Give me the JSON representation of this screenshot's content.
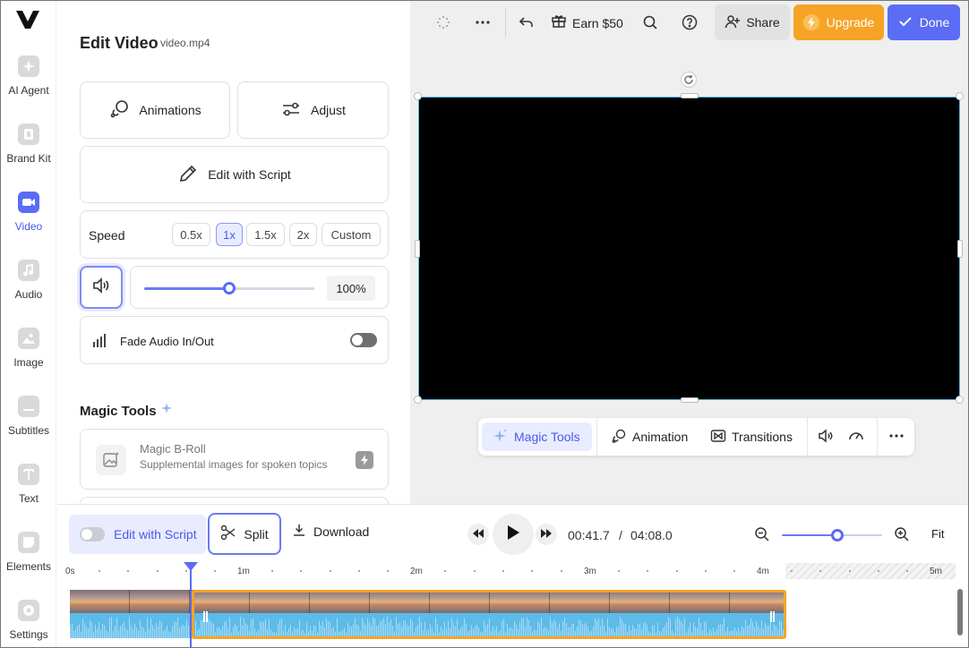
{
  "sidebar": {
    "items": [
      {
        "label": "AI Agent",
        "icon": "sparkle-icon"
      },
      {
        "label": "Brand Kit",
        "icon": "brand-kit-icon"
      },
      {
        "label": "Video",
        "icon": "video-camera-icon",
        "active": true
      },
      {
        "label": "Audio",
        "icon": "music-note-icon"
      },
      {
        "label": "Image",
        "icon": "image-icon"
      },
      {
        "label": "Subtitles",
        "icon": "subtitles-icon"
      },
      {
        "label": "Text",
        "icon": "text-icon"
      },
      {
        "label": "Elements",
        "icon": "elements-icon"
      },
      {
        "label": "Settings",
        "icon": "gear-icon"
      }
    ]
  },
  "panel": {
    "title": "Edit Video",
    "filename": "video.mp4",
    "animations_label": "Animations",
    "adjust_label": "Adjust",
    "edit_script_label": "Edit with Script",
    "speed_label": "Speed",
    "speed_options": [
      "0.5x",
      "1x",
      "1.5x",
      "2x",
      "Custom"
    ],
    "speed_selected": "1x",
    "volume_value": "100%",
    "volume_level": 0.5,
    "fade_label": "Fade Audio In/Out",
    "fade_on": false,
    "magic_tools_title": "Magic Tools",
    "magic_broll_title": "Magic B-Roll",
    "magic_broll_sub": "Supplemental images for spoken topics"
  },
  "toolbar": {
    "earn_label": "Earn $50",
    "share_label": "Share",
    "upgrade_label": "Upgrade",
    "done_label": "Done"
  },
  "floatbar": {
    "magic_tools_label": "Magic Tools",
    "animation_label": "Animation",
    "transitions_label": "Transitions"
  },
  "timeline": {
    "edit_script_label": "Edit with Script",
    "split_label": "Split",
    "download_label": "Download",
    "current_time": "00:41.7",
    "separator": "/",
    "total_time": "04:08.0",
    "fit_label": "Fit",
    "ruler_labels": [
      "0s",
      "1m",
      "2m",
      "3m",
      "4m",
      "5m"
    ],
    "zoom_level": 0.55
  },
  "colors": {
    "accent": "#5b6cf5",
    "upgrade": "#f7a325",
    "selection": "#f7a325",
    "waveform": "#5dbbe8"
  }
}
